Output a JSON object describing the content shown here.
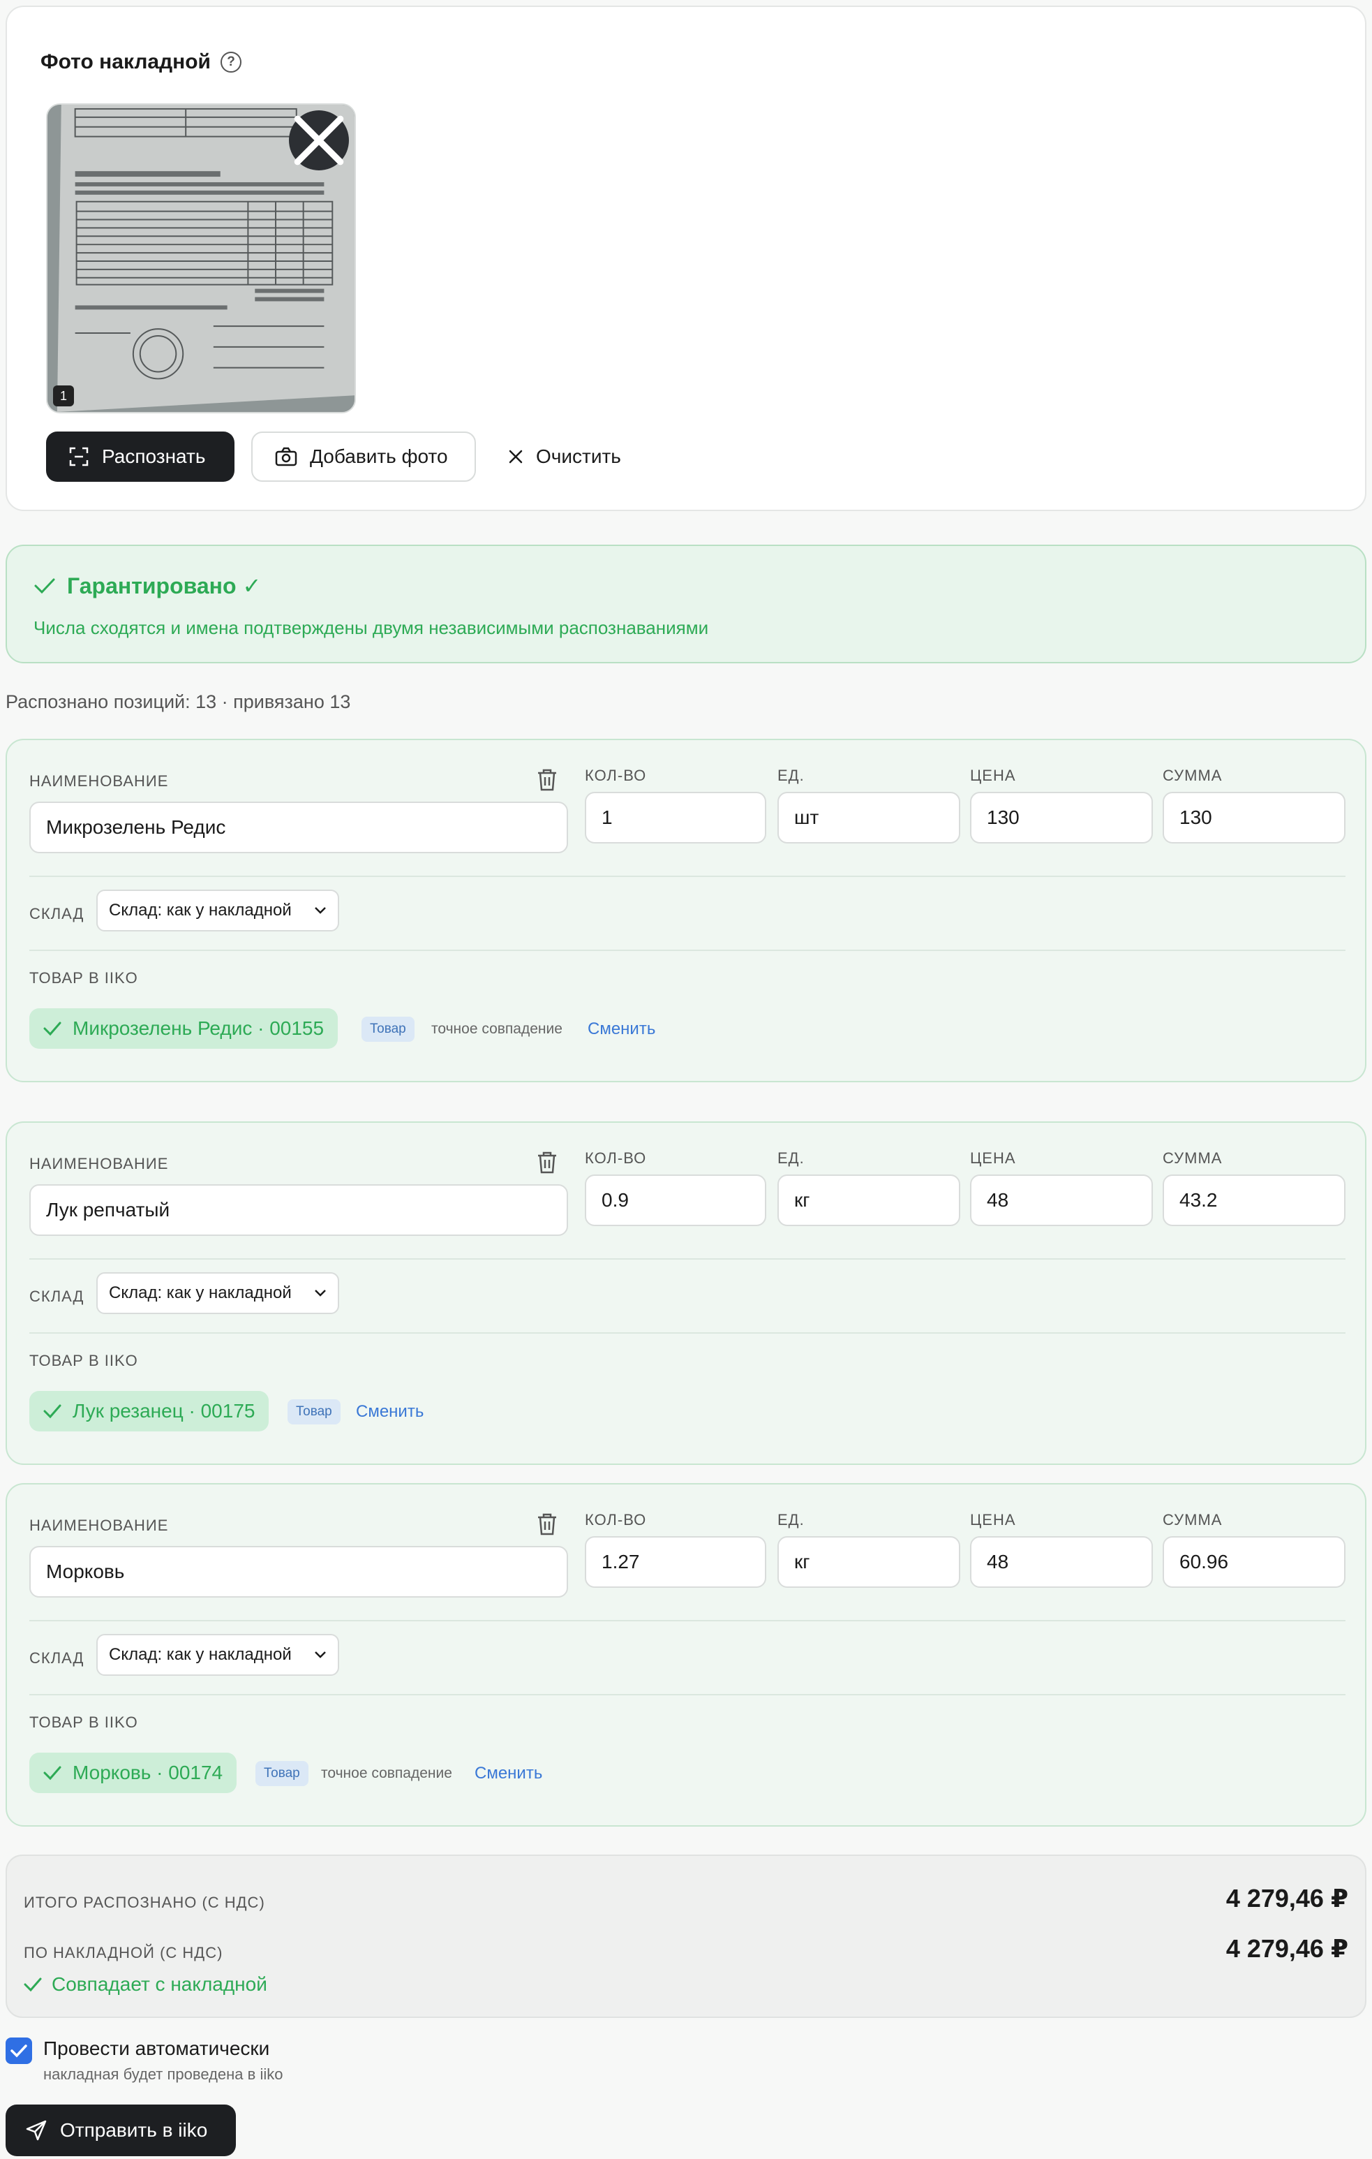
{
  "photo_section": {
    "title": "Фото накладной",
    "help_icon": "question-circle-icon",
    "thumbnail_badge": "1",
    "close_icon": "close-icon",
    "buttons": {
      "recognize": "Распознать",
      "add_photo": "Добавить фото",
      "clear": "Очистить"
    }
  },
  "banner": {
    "title": "Гарантировано ✓",
    "subtitle": "Числа сходятся и имена подтверждены двумя независимыми распознаваниями"
  },
  "summary_line": "Распознано позиций: 13 · привязано 13",
  "labels": {
    "name": "НАИМЕНОВАНИЕ",
    "qty": "КОЛ-ВО",
    "unit": "ЕД.",
    "price": "ЦЕНА",
    "sum": "СУММА",
    "warehouse": "СКЛАД",
    "iiko_product": "ТОВАР В IIKO"
  },
  "items": [
    {
      "name": "Микрозелень Редис",
      "qty": "1",
      "unit": "шт",
      "price": "130",
      "sum": "130",
      "warehouse": "Склад: как у накладной",
      "iiko_match": "Микрозелень Редис · 00155",
      "tag": "Товар",
      "match_note": "точное совпадение",
      "change_link": "Сменить"
    },
    {
      "name": "Лук репчатый",
      "qty": "0.9",
      "unit": "кг",
      "price": "48",
      "sum": "43.2",
      "warehouse": "Склад: как у накладной",
      "iiko_match": "Лук резанец · 00175",
      "tag": "Товар",
      "match_note": "",
      "change_link": "Сменить"
    },
    {
      "name": "Морковь",
      "qty": "1.27",
      "unit": "кг",
      "price": "48",
      "sum": "60.96",
      "warehouse": "Склад: как у накладной",
      "iiko_match": "Морковь · 00174",
      "tag": "Товар",
      "match_note": "точное совпадение",
      "change_link": "Сменить"
    }
  ],
  "totals": {
    "recognized_label": "ИТОГО РАСПОЗНАНО (С НДС)",
    "recognized_value": "4 279,46 ₽",
    "invoice_label": "ПО НАКЛАДНОЙ (С НДС)",
    "invoice_value": "4 279,46 ₽",
    "match_status": "Совпадает с накладной"
  },
  "auto_post": {
    "checked": true,
    "label": "Провести автоматически",
    "sublabel": "накладная будет проведена в iiko"
  },
  "send_button": "Отправить в iiko",
  "colors": {
    "accent_green": "#2daa55",
    "link_blue": "#3a78d6",
    "checkbox_blue": "#2f6fe4",
    "dark_button": "#1d1f22"
  }
}
